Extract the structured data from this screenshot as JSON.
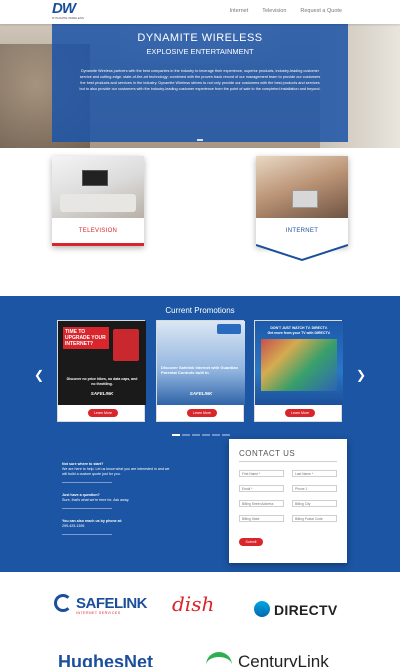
{
  "header": {
    "logo_mark": "DW",
    "logo_text": "DYNAMITE WIRELESS",
    "nav": [
      "Internet",
      "Television",
      "Request a Quote"
    ]
  },
  "hero": {
    "title": "DYNAMITE WIRELESS",
    "subtitle": "EXPLOSIVE ENTERTAINMENT",
    "body": "Dynamite Wireless partners with the best companies in the industry to leverage their experience, superior products, industry-leading customer service and cutting-edge, state-of-the-art technology; combined with the proven track record of our management team to provide our customers the best products and services in the industry. Dynamite Wireless strives to not only provide our customers with the best products and services but to also provide our customers with the industry-leading customer experience from the point of sale to the completed installation and beyond."
  },
  "services": [
    {
      "label": "TELEVISION"
    },
    {
      "label": "INTERNET"
    }
  ],
  "promotions": {
    "title": "Current Promotions",
    "items": [
      {
        "headline": "TIME TO UPGRADE YOUR INTERNET?",
        "detail": "Discover no price hikes, no data caps, and no throttling.",
        "brand": "SAFELINK",
        "button": "Learn More"
      },
      {
        "headline": "Discover Safelink Internet with Guardian Parental Controls built in.",
        "brand": "SAFELINK",
        "button": "Learn More"
      },
      {
        "headline": "DON'T JUST WATCH TV. DIRECTV.",
        "detail": "Get more from your TV with DIRECTV.",
        "button": "Learn More"
      }
    ],
    "carousel_page_count": 6,
    "carousel_active_index": 0
  },
  "contact_info": {
    "q1": "Not sure where to start?",
    "a1": "We are here to help. Let us know what you are interested in and we will build a custom quote just for you.",
    "q2": "Just have a question?",
    "a2": "Sure, that's what we're here for. Ask away.",
    "q3": "You can also reach us by phone at:",
    "phone": "299-425-1395"
  },
  "contact_form": {
    "title": "CONTACT US",
    "first_name": "First Name *",
    "last_name": "Last Name *",
    "email": "Email *",
    "phone": "Phone 1",
    "street": "Billing Street Address",
    "city": "Billing City",
    "state": "Billing State",
    "postal": "Billing Postal Code",
    "submit": "Submit"
  },
  "brands": {
    "safelink": "SAFELINK",
    "safelink_tag": "INTERNET SERVICES",
    "dish": "dish",
    "directv": "DIRECTV",
    "hughesnet": "HughesNet",
    "centurylink": "CenturyLink"
  },
  "colors": {
    "brand_blue": "#1b55a3",
    "accent_red": "#d9262c"
  }
}
